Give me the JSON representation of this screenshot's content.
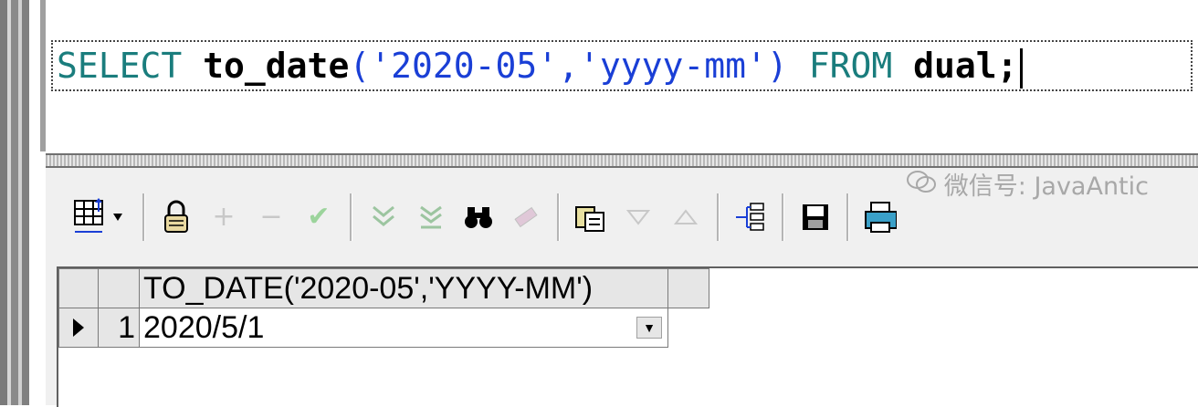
{
  "editor": {
    "sql_tokens": {
      "select": "SELECT",
      "function": "to_date",
      "open_paren": "(",
      "arg1": "'2020-05'",
      "comma": ",",
      "arg2": "'yyyy-mm'",
      "close_paren": ")",
      "from": "FROM",
      "table": "dual;"
    },
    "colors": {
      "keyword": "#1a7d7d",
      "string": "#1a3fd6",
      "identifier": "#000000"
    }
  },
  "toolbar": {
    "icons": [
      "grid-view-icon",
      "lock-icon",
      "add-record-icon",
      "delete-record-icon",
      "post-record-icon",
      "move-down-icon",
      "move-last-icon",
      "find-icon",
      "clear-icon",
      "query-by-example-icon",
      "sort-descending-icon",
      "sort-ascending-icon",
      "tree-view-icon",
      "save-icon",
      "print-icon"
    ]
  },
  "grid": {
    "column_header": "TO_DATE('2020-05','YYYY-MM')",
    "rows": [
      {
        "num": "1",
        "value": "2020/5/1"
      }
    ]
  },
  "watermark": {
    "text": "微信号: JavaAntic"
  }
}
